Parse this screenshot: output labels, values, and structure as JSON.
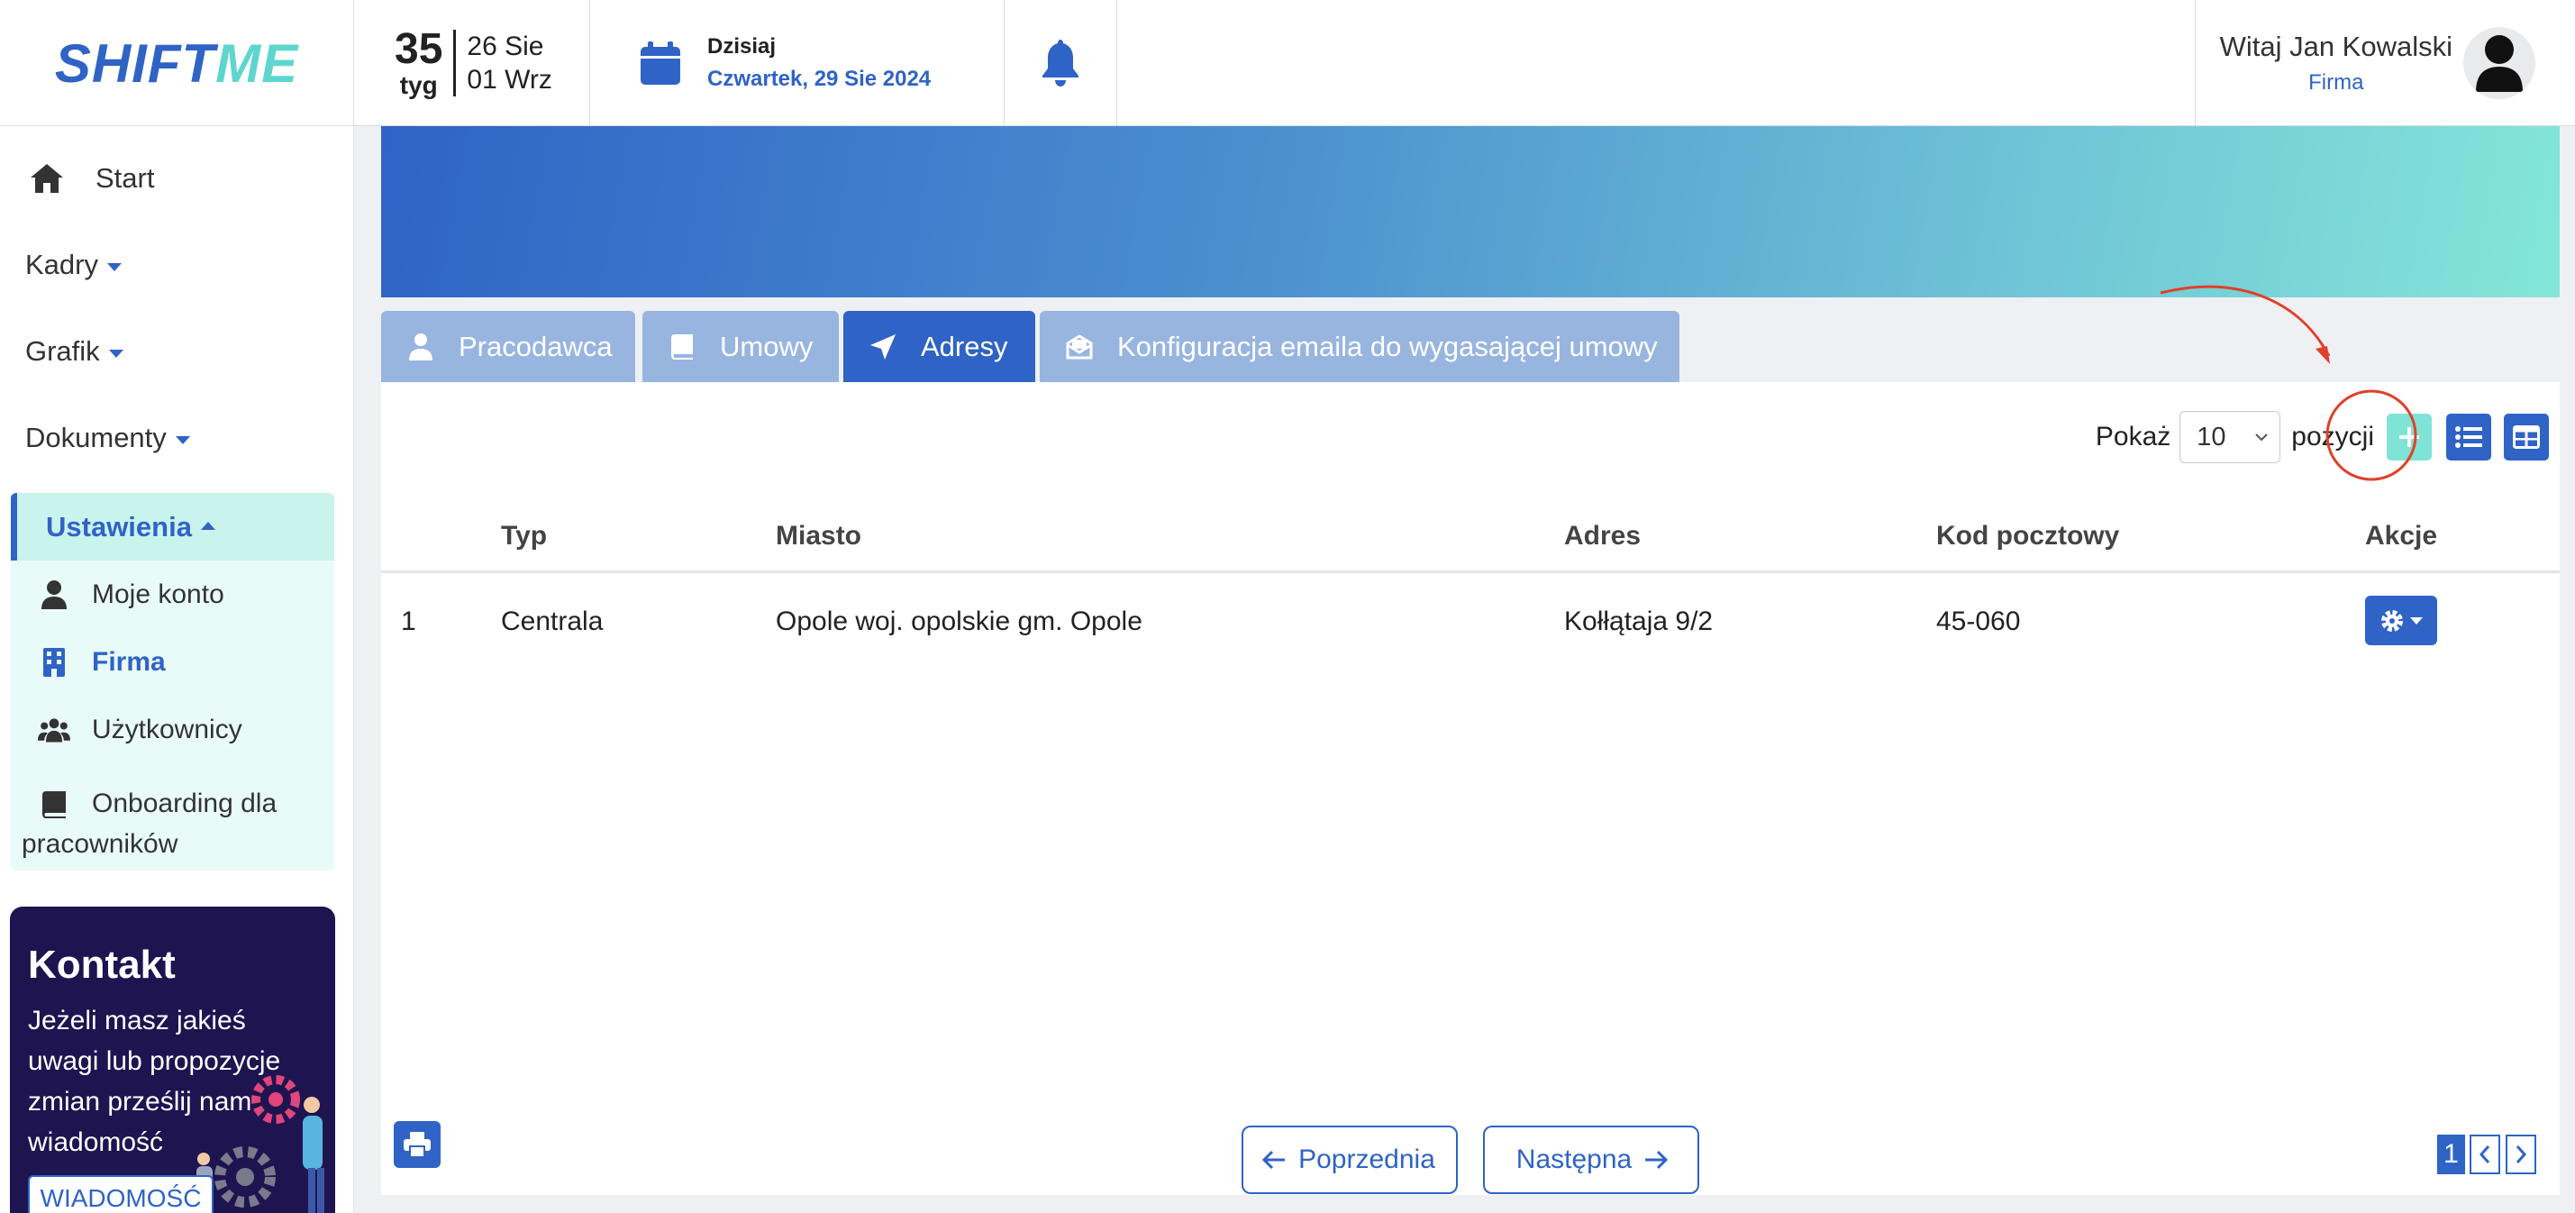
{
  "header": {
    "logo_part1": "SHIFT",
    "logo_part2": "ME",
    "week_number": "35",
    "week_label": "tyg",
    "week_start": "26 Sie",
    "week_end": "01 Wrz",
    "today_label": "Dzisiaj",
    "today_date": "Czwartek, 29 Sie 2024",
    "greeting": "Witaj Jan Kowalski",
    "company_label": "Firma"
  },
  "sidebar": {
    "items": [
      {
        "label": "Start",
        "icon": "home-icon"
      },
      {
        "label": "Kadry"
      },
      {
        "label": "Grafik"
      },
      {
        "label": "Dokumenty"
      }
    ],
    "settings": {
      "label": "Ustawienia",
      "sub_items": [
        {
          "label": "Moje konto",
          "icon": "user-icon"
        },
        {
          "label": "Firma",
          "icon": "building-icon"
        },
        {
          "label": "Użytkownicy",
          "icon": "users-icon"
        },
        {
          "label_line1": "Onboarding dla",
          "label_line2": "pracowników",
          "icon": "book-icon"
        }
      ]
    },
    "contact": {
      "title": "Kontakt",
      "text": "Jeżeli masz jakieś uwagi lub propozycje zmian prześlij nam wiadomość",
      "button": "WIADOMOŚĆ"
    }
  },
  "tabs": [
    {
      "label": "Pracodawca",
      "icon": "person-icon"
    },
    {
      "label": "Umowy",
      "icon": "book-icon"
    },
    {
      "label": "Adresy",
      "icon": "location-arrow-icon",
      "active": true
    },
    {
      "label": "Konfiguracja emaila do wygasającej umowy",
      "icon": "envelope-open-icon"
    }
  ],
  "toolbar": {
    "show_label": "Pokaż",
    "page_size": "10",
    "positions_label": "pozycji"
  },
  "table": {
    "columns": [
      "",
      "Typ",
      "Miasto",
      "Adres",
      "Kod pocztowy",
      "Akcje"
    ],
    "rows": [
      {
        "num": "1",
        "type": "Centrala",
        "city": "Opole woj. opolskie gm. Opole",
        "address": "Kołłątaja 9/2",
        "postal": "45-060"
      }
    ]
  },
  "pagination": {
    "prev": "Poprzednia",
    "next": "Następna",
    "current_page": "1"
  },
  "colors": {
    "primary": "#2f63c6",
    "accent": "#7fe3d6",
    "annotation": "#e0402a"
  }
}
